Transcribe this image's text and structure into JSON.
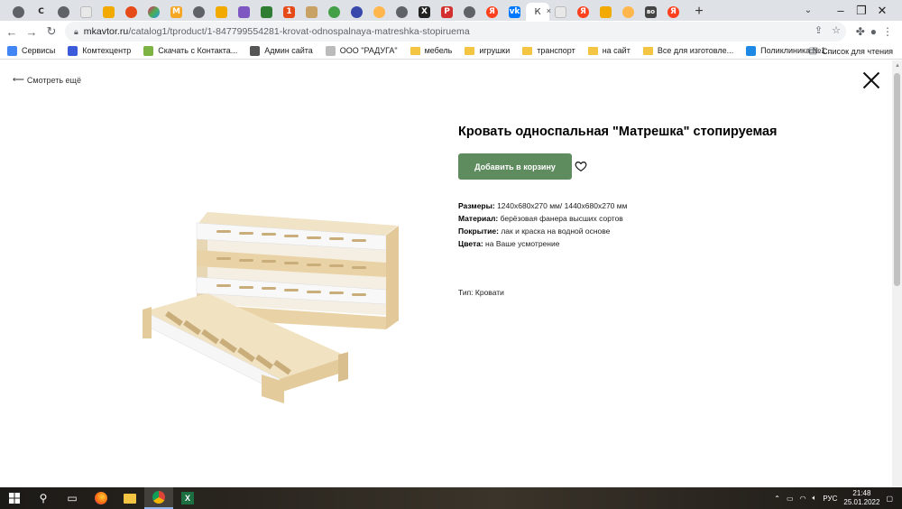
{
  "browser": {
    "active_tab": {
      "icon_letter": "К",
      "close": "×"
    },
    "new_tab": "+",
    "url_host": "mkavtor.ru",
    "url_path": "/catalog1/tproduct/1-847799554281-krovat-odnospalnaya-matreshka-stopiruema",
    "bookmarks": [
      {
        "label": "Сервисы",
        "icon": "apps-grid-icon",
        "color": "#4285f4"
      },
      {
        "label": "Комтехцентр",
        "icon": "site-icon",
        "color": "#3b5bdb"
      },
      {
        "label": "Скачать с Контакта...",
        "icon": "leaf-icon",
        "color": "#7cb342"
      },
      {
        "label": "Админ сайта",
        "icon": "chrome-icon",
        "color": "#555555"
      },
      {
        "label": "ООО \"РАДУГА\"",
        "icon": "page-icon",
        "color": "#bbbbbb"
      },
      {
        "label": "мебель",
        "icon": "folder-icon",
        "color": "#f4c542"
      },
      {
        "label": "игрушки",
        "icon": "folder-icon",
        "color": "#f4c542"
      },
      {
        "label": "транспорт",
        "icon": "folder-icon",
        "color": "#f4c542"
      },
      {
        "label": "на сайт",
        "icon": "folder-icon",
        "color": "#f4c542"
      },
      {
        "label": "Все для изготовле...",
        "icon": "folder-icon",
        "color": "#f4c542"
      },
      {
        "label": "Поликлиника №1...",
        "icon": "send-icon",
        "color": "#1e88e5"
      }
    ],
    "reading_list": "Список для чтения"
  },
  "page": {
    "back_link": "Смотреть ещё",
    "title": "Кровать односпальная \"Матрешка\" стопируемая",
    "buy_button": "Добавить в корзину",
    "props": [
      {
        "key": "Размеры:",
        "value": "1240х680х270 мм/ 1440х680х270 мм"
      },
      {
        "key": "Материал:",
        "value": "берёзовая фанера высших сортов"
      },
      {
        "key": "Покрытие:",
        "value": "лак и краска на водной основе"
      },
      {
        "key": "Цвета:",
        "value": "на Ваше усмотрение"
      }
    ],
    "type_line": "Тип: Кровати"
  },
  "taskbar": {
    "lang": "РУС",
    "time": "21:48",
    "date": "25.01.2022"
  },
  "colors": {
    "accent_button": "#5f8c5f",
    "tab_strip": "#dee1e6",
    "omnibox": "#f1f3f4",
    "taskbar": "#2c2720"
  }
}
